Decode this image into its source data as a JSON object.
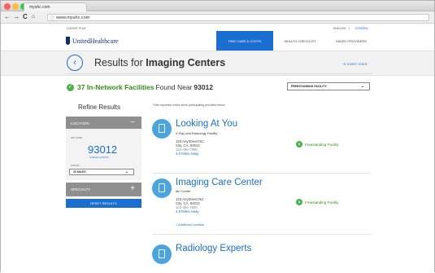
{
  "browser": {
    "tab_title": "myuhc.com",
    "url": "www.myuhc.com"
  },
  "header": {
    "choice_plus": "CHOICE PLUS",
    "lang_english": "ENGLISH",
    "lang_sep": "|",
    "lang_espanol": "ESPAÑOL",
    "logo_text": "UnitedHealthcare",
    "nav": [
      {
        "label": "FIND CARE & COSTS"
      },
      {
        "label": "HEALTH CHECKLIST"
      },
      {
        "label": "SAVED PROVIDERS"
      }
    ]
  },
  "results": {
    "back_symbol": "‹",
    "title_prefix": "Results for",
    "title_bold": "Imaging Centers",
    "start_over": "START OVER",
    "count_text": "37 In-Network Facilities",
    "found_near": "Found Near",
    "zip": "93012",
    "facility_filter": "FREESTANDING FACILITY"
  },
  "refine": {
    "title": "Refine Results",
    "location_label": "LOCATION",
    "location_symbol": "−",
    "zip_label": "ZIP CODE",
    "zip_value": "93012",
    "change_location": "CHANGE LOCATION",
    "within_label": "WITHIN",
    "within_value": "20 MILES",
    "specialty_label": "SPECIALTY",
    "specialty_symbol": "+",
    "reset_button": "RESET RESULTS"
  },
  "notice": "*See important notice about participating providers below",
  "listings": [
    {
      "name": "Looking At You",
      "type": "X-Ray and Radiology Facility",
      "street": "123 AnyStreet Rd.",
      "city": "City, CA, 93012",
      "phone": "123-456-7890",
      "distance": "4.8 Miles Away",
      "badge": "Freestanding Facility"
    },
    {
      "name": "Imaging Care Center",
      "type": "Mri Center",
      "street": "123 AnyStreet Rd.",
      "city": "City, CA, 93012",
      "phone": "123-456-7890",
      "distance": "4.8 Miles Away",
      "badge": "Freestanding Facility",
      "additional": "1 Additional Location"
    },
    {
      "name": "Radiology Experts"
    }
  ],
  "colors": {
    "brand_blue": "#196ecf",
    "green": "#4caf50"
  }
}
